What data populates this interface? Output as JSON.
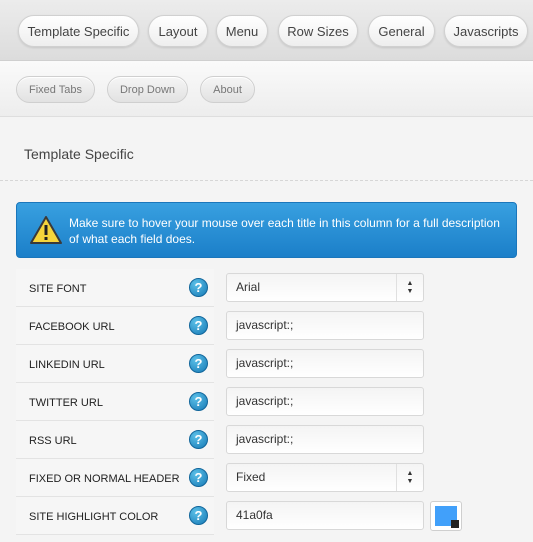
{
  "main_tabs": [
    "Template Specific",
    "Layout",
    "Menu",
    "Row Sizes",
    "General",
    "Javascripts"
  ],
  "sub_tabs": [
    "Fixed Tabs",
    "Drop Down",
    "About"
  ],
  "section_title": "Template Specific",
  "alert": {
    "icon": "warning-icon",
    "text": "Make sure to hover your mouse over each title in this column for a full description of what each field does."
  },
  "help_glyph": "?",
  "fields": [
    {
      "label": "SITE FONT",
      "type": "select",
      "value": "Arial"
    },
    {
      "label": "FACEBOOK URL",
      "type": "text",
      "value": "javascript:;"
    },
    {
      "label": "LINKEDIN URL",
      "type": "text",
      "value": "javascript:;"
    },
    {
      "label": "TWITTER URL",
      "type": "text",
      "value": "javascript:;"
    },
    {
      "label": "RSS URL",
      "type": "text",
      "value": "javascript:;"
    },
    {
      "label": "FIXED OR NORMAL HEADER",
      "type": "select",
      "value": "Fixed"
    },
    {
      "label": "SITE HIGHLIGHT COLOR",
      "type": "color",
      "value": "41a0fa"
    }
  ],
  "colors": {
    "alert_bg": "#2a8fd6",
    "highlight_swatch": "#41a0fa"
  }
}
